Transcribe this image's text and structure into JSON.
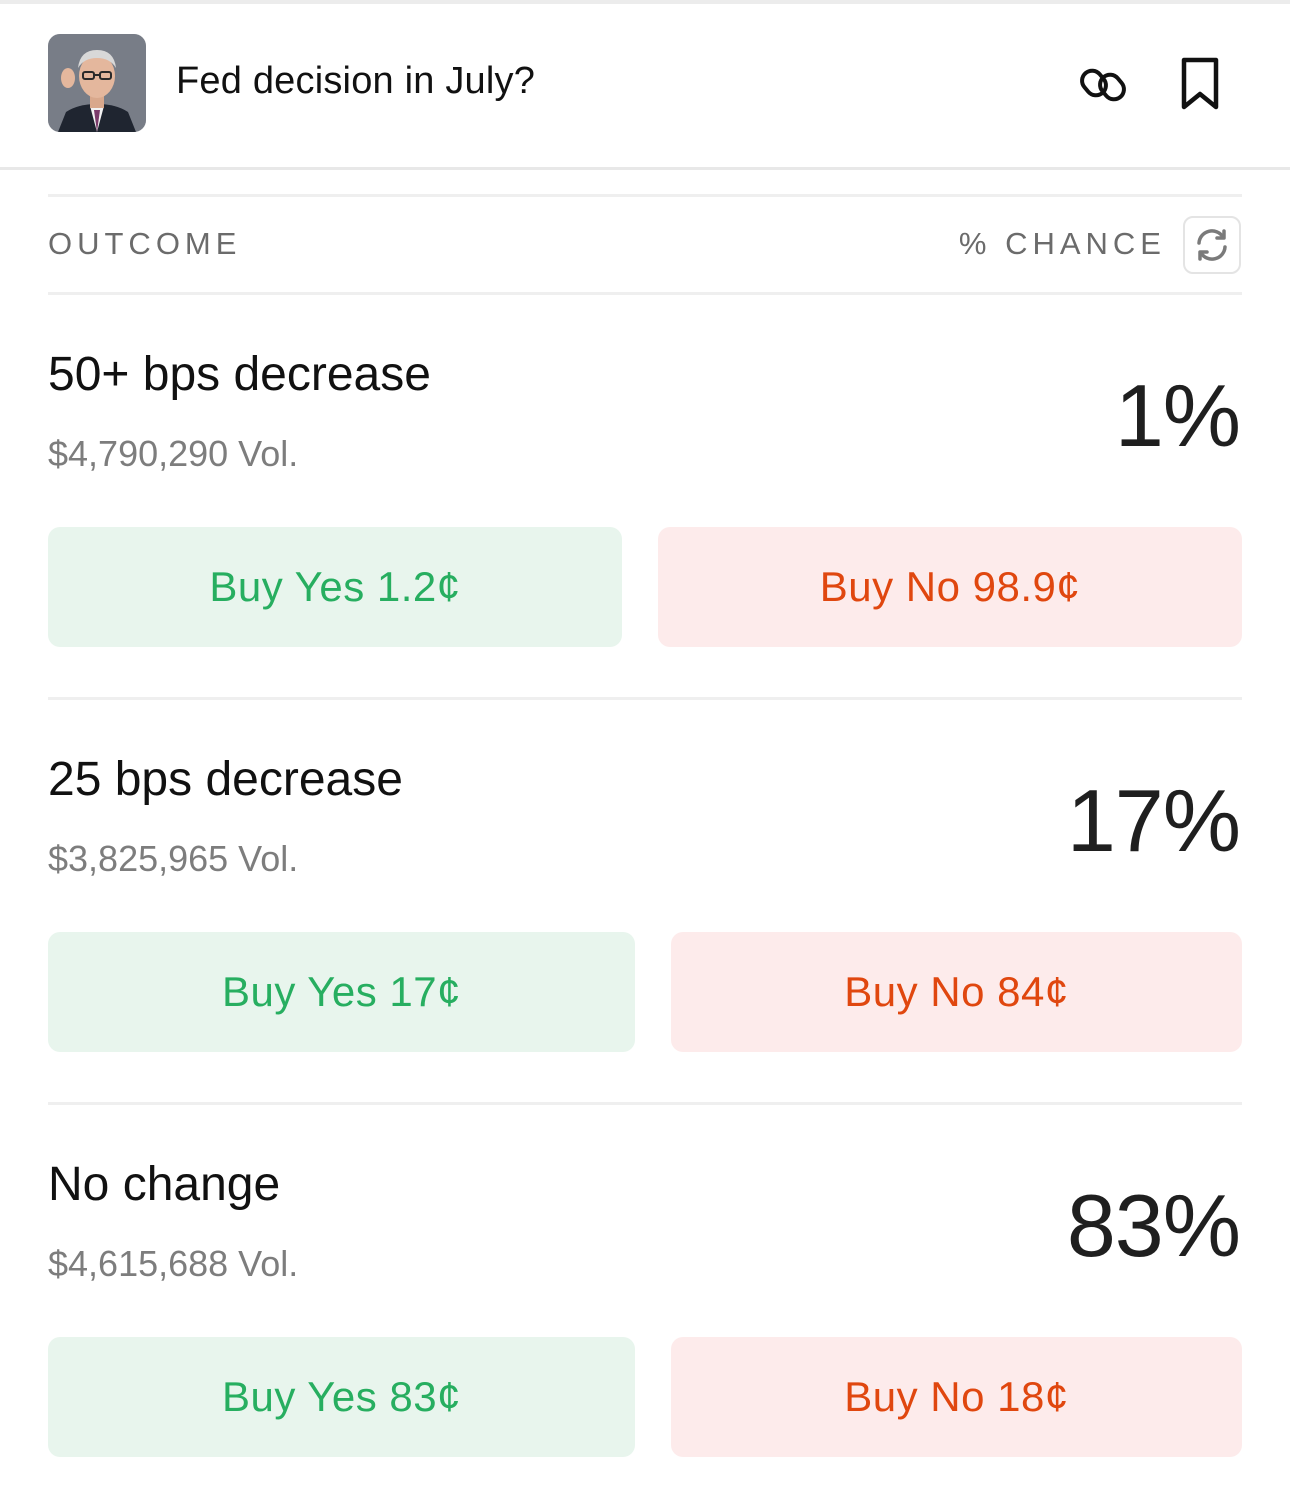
{
  "header": {
    "title": "Fed decision in July?",
    "avatar_alt": "market-thumbnail"
  },
  "table": {
    "outcome_header": "OUTCOME",
    "chance_header": "% CHANCE"
  },
  "outcomes": [
    {
      "name": "50+ bps decrease",
      "volume": "$4,790,290 Vol.",
      "chance": "1%",
      "yes_label": "Buy Yes 1.2¢",
      "no_label": "Buy No 98.9¢"
    },
    {
      "name": "25 bps decrease",
      "volume": "$3,825,965 Vol.",
      "chance": "17%",
      "yes_label": "Buy Yes 17¢",
      "no_label": "Buy No 84¢"
    },
    {
      "name": "No change",
      "volume": "$4,615,688 Vol.",
      "chance": "83%",
      "yes_label": "Buy Yes 83¢",
      "no_label": "Buy No 18¢"
    }
  ],
  "colors": {
    "yes_text": "#27ae60",
    "yes_bg": "#e8f5ed",
    "no_text": "#e0470f",
    "no_bg": "#fdebeb"
  },
  "icons": [
    "link-icon",
    "bookmark-icon",
    "refresh-icon"
  ]
}
